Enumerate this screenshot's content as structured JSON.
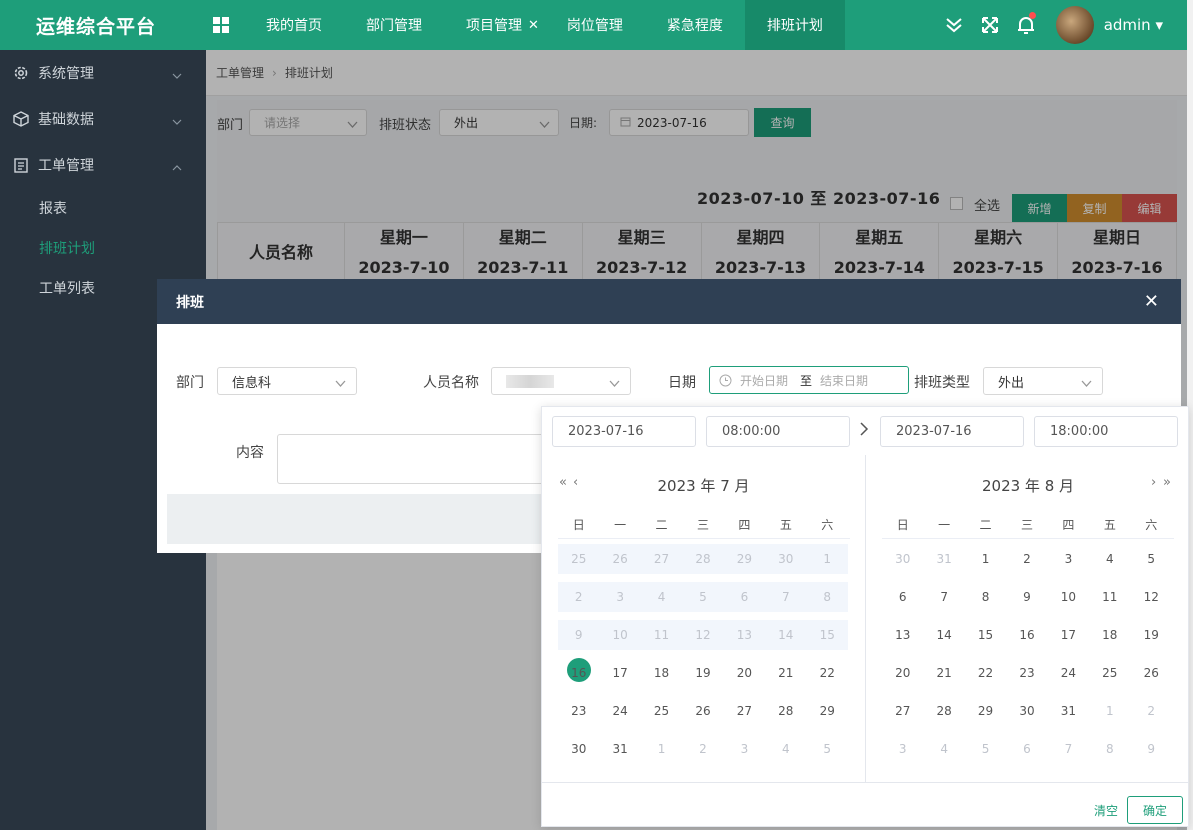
{
  "app": {
    "title": "运维综合平台",
    "user": "admin"
  },
  "nav_tabs": [
    {
      "label": "我的首页"
    },
    {
      "label": "部门管理"
    },
    {
      "label": "项目管理",
      "closable": true
    },
    {
      "label": "岗位管理"
    },
    {
      "label": "紧急程度"
    },
    {
      "label": "排班计划",
      "active": true
    }
  ],
  "sidebar": {
    "items": [
      {
        "label": "系统管理",
        "icon": "gear-icon"
      },
      {
        "label": "基础数据",
        "icon": "cube-icon"
      },
      {
        "label": "工单管理",
        "icon": "clipboard-icon",
        "expanded": true
      }
    ],
    "subitems": [
      {
        "label": "报表"
      },
      {
        "label": "排班计划",
        "active": true
      },
      {
        "label": "工单列表"
      }
    ]
  },
  "breadcrumb": {
    "parent": "工单管理",
    "current": "排班计划"
  },
  "filter": {
    "dept_label": "部门",
    "dept_placeholder": "请选择",
    "status_label": "排班状态",
    "status_value": "外出",
    "date_label": "日期:",
    "date_value": "2023-07-16",
    "query_label": "查询",
    "range_title": "2023-07-10 至 2023-07-16",
    "select_all_label": "全选",
    "add_label": "新增",
    "copy_label": "复制",
    "edit_label": "编辑"
  },
  "schedule": {
    "name_header": "人员名称",
    "days": [
      {
        "weekday": "星期一",
        "date": "2023-7-10"
      },
      {
        "weekday": "星期二",
        "date": "2023-7-11"
      },
      {
        "weekday": "星期三",
        "date": "2023-7-12"
      },
      {
        "weekday": "星期四",
        "date": "2023-7-13"
      },
      {
        "weekday": "星期五",
        "date": "2023-7-14"
      },
      {
        "weekday": "星期六",
        "date": "2023-7-15"
      },
      {
        "weekday": "星期日",
        "date": "2023-7-16"
      }
    ]
  },
  "dialog": {
    "title": "排班",
    "dept_label": "部门",
    "dept_value": "信息科",
    "person_label": "人员名称",
    "date_label": "日期",
    "start_placeholder": "开始日期",
    "range_sep": "至",
    "end_placeholder": "结束日期",
    "type_label": "排班类型",
    "type_value": "外出",
    "content_label": "内容"
  },
  "picker": {
    "start_date": "2023-07-16",
    "start_time": "08:00:00",
    "end_date": "2023-07-16",
    "end_time": "18:00:00",
    "weekdays": [
      "日",
      "一",
      "二",
      "三",
      "四",
      "五",
      "六"
    ],
    "left_title": "2023 年 7 月",
    "right_title": "2023 年 8 月",
    "left_weeks": [
      [
        "25",
        "26",
        "27",
        "28",
        "29",
        "30",
        "1"
      ],
      [
        "2",
        "3",
        "4",
        "5",
        "6",
        "7",
        "8"
      ],
      [
        "9",
        "10",
        "11",
        "12",
        "13",
        "14",
        "15"
      ],
      [
        "16",
        "17",
        "18",
        "19",
        "20",
        "21",
        "22"
      ],
      [
        "23",
        "24",
        "25",
        "26",
        "27",
        "28",
        "29"
      ],
      [
        "30",
        "31",
        "1",
        "2",
        "3",
        "4",
        "5"
      ]
    ],
    "right_weeks": [
      [
        "30",
        "31",
        "1",
        "2",
        "3",
        "4",
        "5"
      ],
      [
        "6",
        "7",
        "8",
        "9",
        "10",
        "11",
        "12"
      ],
      [
        "13",
        "14",
        "15",
        "16",
        "17",
        "18",
        "19"
      ],
      [
        "20",
        "21",
        "22",
        "23",
        "24",
        "25",
        "26"
      ],
      [
        "27",
        "28",
        "29",
        "30",
        "31",
        "1",
        "2"
      ],
      [
        "3",
        "4",
        "5",
        "6",
        "7",
        "8",
        "9"
      ]
    ],
    "today": "16",
    "clear_label": "清空",
    "confirm_label": "确定"
  },
  "colors": {
    "primary": "#1e9e7a",
    "sidebar": "#28333e",
    "dialog_header": "#2f4054",
    "copy": "#d28f2e",
    "edit": "#d9534f"
  }
}
